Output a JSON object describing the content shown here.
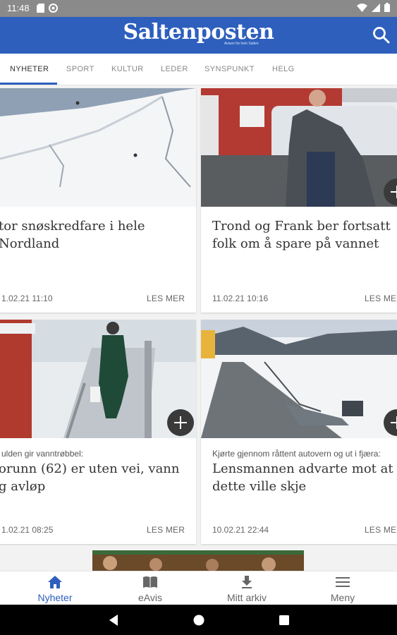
{
  "status_bar": {
    "time": "11:48",
    "icons": [
      "sd-card-icon",
      "sync-icon",
      "wifi-icon",
      "signal-icon",
      "battery-icon"
    ]
  },
  "app_bar": {
    "logo": "Saltenposten",
    "logo_tagline": "Avisen for hele Salten",
    "search_icon": "search-icon",
    "color": "#2e5fbd"
  },
  "tabs": [
    {
      "label": "NYHETER",
      "active": true
    },
    {
      "label": "SPORT"
    },
    {
      "label": "KULTUR"
    },
    {
      "label": "LEDER"
    },
    {
      "label": "SYNSPUNKT"
    },
    {
      "label": "HELG"
    }
  ],
  "articles": [
    {
      "kicker": "",
      "headline": [
        "tor snøskredfare i hele",
        "Nordland"
      ],
      "date": "1.02.21 11:10",
      "action": "LES MER",
      "image": "snow-slope-avalanche"
    },
    {
      "kicker": "",
      "headline": [
        "Trond og Frank ber fortsatt",
        "folk om å spare på vannet"
      ],
      "date": "11.02.21 10:16",
      "action": "LES ME",
      "image": "man-by-car-red-building"
    },
    {
      "kicker": "ulden gir vanntrøbbel:",
      "headline": [
        "orunn (62) er uten vei, vann",
        "g avløp"
      ],
      "date": "1.02.21 08:25",
      "action": "LES MER",
      "image": "person-carrying-water"
    },
    {
      "kicker": "Kjørte gjennom råttent autovern og ut i fjæra:",
      "headline": [
        "Lensmannen advarte mot at",
        "dette ville skje"
      ],
      "date": "10.02.21 22:44",
      "action": "LES ME",
      "image": "car-in-snowy-shore"
    }
  ],
  "bottom_nav": [
    {
      "label": "Nyheter",
      "icon": "home-icon",
      "active": true
    },
    {
      "label": "eAvis",
      "icon": "book-icon"
    },
    {
      "label": "Mitt arkiv",
      "icon": "download-icon"
    },
    {
      "label": "Meny",
      "icon": "menu-icon"
    }
  ],
  "system_nav": [
    "back-icon",
    "home-circle-icon",
    "recents-icon"
  ]
}
